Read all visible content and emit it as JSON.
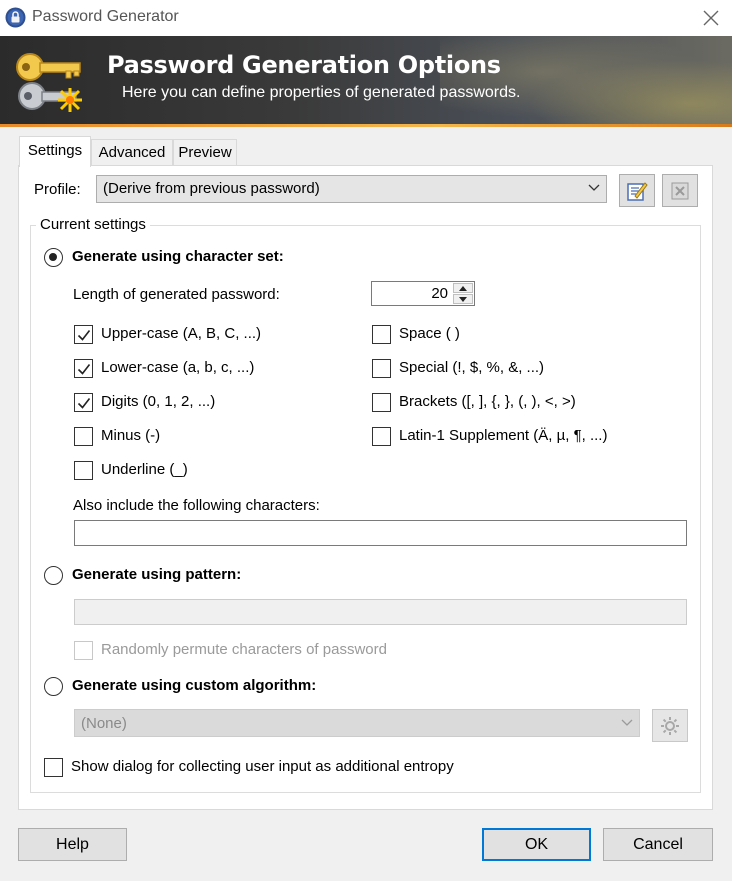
{
  "window": {
    "title": "Password Generator",
    "icon": "lock-icon",
    "close_icon": "close-icon"
  },
  "banner": {
    "title": "Password Generation Options",
    "subtitle": "Here you can define properties of generated passwords.",
    "icon": "keys-icon"
  },
  "tabs": [
    {
      "label": "Settings",
      "active": true
    },
    {
      "label": "Advanced",
      "active": false
    },
    {
      "label": "Preview",
      "active": false
    }
  ],
  "profile": {
    "label": "Profile:",
    "value": "(Derive from previous password)",
    "edit_icon": "edit-profile-icon",
    "delete_icon": "delete-profile-icon"
  },
  "current_settings": {
    "legend": "Current settings",
    "charset_radio": {
      "label": "Generate using character set:",
      "checked": true
    },
    "length": {
      "label": "Length of generated password:",
      "value": "20"
    },
    "options_left": [
      {
        "label": "Upper-case (A, B, C, ...)",
        "checked": true
      },
      {
        "label": "Lower-case (a, b, c, ...)",
        "checked": true
      },
      {
        "label": "Digits (0, 1, 2, ...)",
        "checked": true
      },
      {
        "label": "Minus (-)",
        "checked": false
      },
      {
        "label": "Underline (_)",
        "checked": false
      }
    ],
    "options_right": [
      {
        "label": "Space ( )",
        "checked": false
      },
      {
        "label": "Special (!, $, %, &, ...)",
        "checked": false
      },
      {
        "label": "Brackets ([, ], {, }, (, ), <, >)",
        "checked": false
      },
      {
        "label": "Latin-1 Supplement (Ä, µ, ¶, ...)",
        "checked": false
      }
    ],
    "also_include": {
      "label": "Also include the following characters:",
      "value": ""
    },
    "pattern_radio": {
      "label": "Generate using pattern:",
      "checked": false
    },
    "pattern_value": "",
    "permute": {
      "label": "Randomly permute characters of password",
      "checked": false,
      "disabled": true
    },
    "custom_radio": {
      "label": "Generate using custom algorithm:",
      "checked": false
    },
    "custom_algorithm": {
      "value": "(None)",
      "disabled": true
    },
    "entropy": {
      "label": "Show dialog for collecting user input as additional entropy",
      "checked": false
    }
  },
  "buttons": {
    "help": "Help",
    "ok": "OK",
    "cancel": "Cancel"
  },
  "colors": {
    "accent": "#0078d7",
    "banner_orange": "#e88a2a",
    "banner_dark": "#2b2b2b"
  }
}
